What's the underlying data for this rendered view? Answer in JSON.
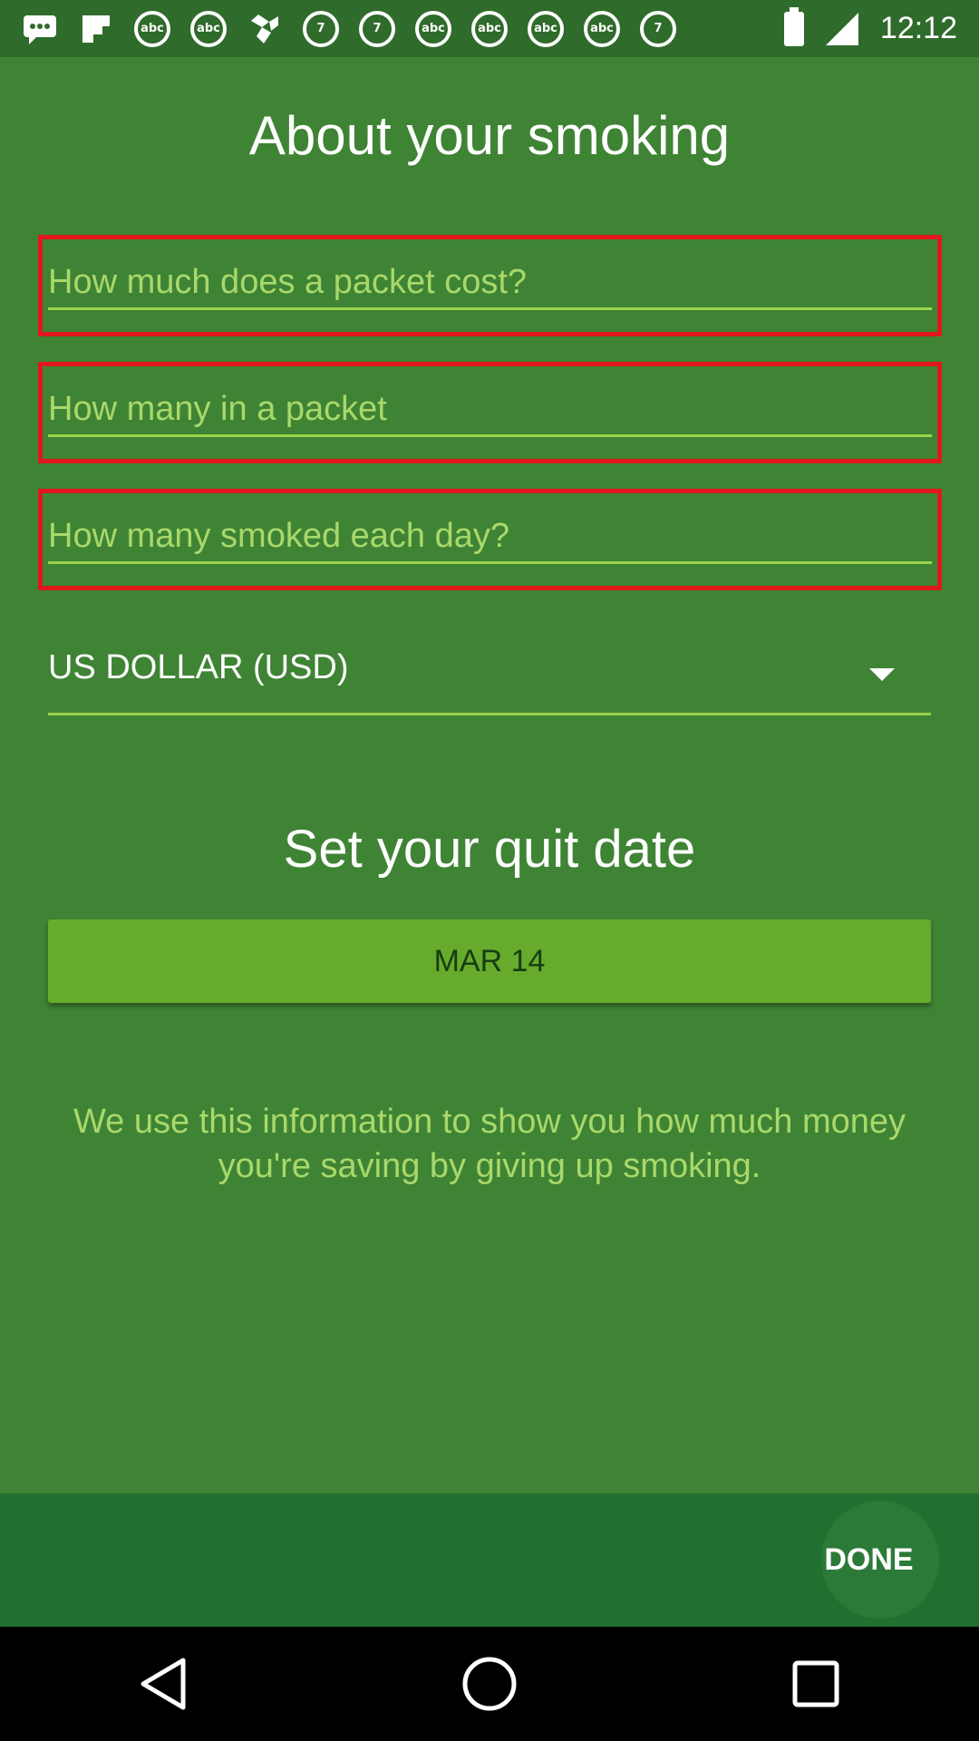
{
  "status_bar": {
    "time": "12:12",
    "icons": [
      "message-icon",
      "flipboard-icon",
      "abc-news-icon",
      "abc-news-icon",
      "abc-news-icon",
      "dropbox-icon",
      "abc7-icon",
      "abc7-icon",
      "abc-news-icon",
      "abc-news-icon",
      "abc-news-icon",
      "abc-news-icon",
      "abc7-icon"
    ],
    "abc_label": "abc"
  },
  "screen": {
    "title": "About your smoking",
    "fields": [
      {
        "placeholder": "How much does a packet cost?",
        "value": ""
      },
      {
        "placeholder": "How many in a packet",
        "value": ""
      },
      {
        "placeholder": "How many smoked each day?",
        "value": ""
      }
    ],
    "currency": {
      "selected": "US DOLLAR (USD)"
    },
    "quit_title": "Set your quit date",
    "quit_date": "MAR 14",
    "info_text": "We use this information to show you how much money you're saving by giving up smoking."
  },
  "action_bar": {
    "done_label": "DONE"
  },
  "colors": {
    "background": "#3f8434",
    "status_bar": "#2f6b2a",
    "action_bar": "#21702f",
    "date_button": "#67ab2c",
    "error_border": "#e0181c",
    "accent_text": "#a9d86b"
  }
}
